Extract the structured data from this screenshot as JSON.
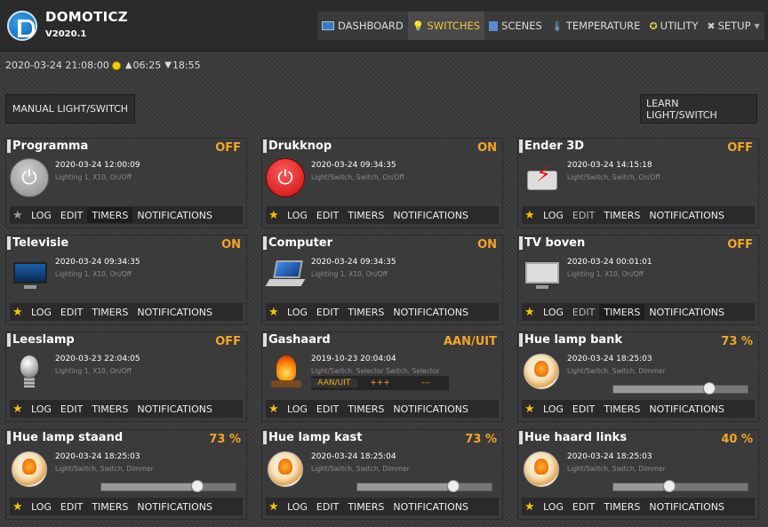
{
  "app": {
    "title": "DOMOTICZ",
    "version": "V2020.1"
  },
  "nav": [
    {
      "label": "DASHBOARD",
      "icon": "dashboard-icon"
    },
    {
      "label": "SWITCHES",
      "icon": "lightbulb-icon",
      "active": true
    },
    {
      "label": "SCENES",
      "icon": "scenes-icon"
    },
    {
      "label": "TEMPERATURE",
      "icon": "thermometer-icon"
    },
    {
      "label": "UTILITY",
      "icon": "utility-icon"
    },
    {
      "label": "SETUP",
      "icon": "tools-icon"
    }
  ],
  "datebar": {
    "datetime": "2020-03-24 21:08:00",
    "sunrise": "06:25",
    "sunset": "18:55"
  },
  "buttons": {
    "manual": "MANUAL LIGHT/SWITCH",
    "learn": "LEARN LIGHT/SWITCH"
  },
  "bar_labels": {
    "log": "LOG",
    "edit": "EDIT",
    "timers": "TIMERS",
    "notifications": "NOTIFICATIONS"
  },
  "colors": {
    "accent": "#f6c343",
    "status": "#f5a623"
  },
  "devices": [
    {
      "name": "Programma",
      "status": "OFF",
      "date": "2020-03-24 12:00:09",
      "type": "Lighting 1, X10, On/Off",
      "icon": "power-button-icon",
      "favorite": false
    },
    {
      "name": "Drukknop",
      "status": "ON",
      "date": "2020-03-24 09:34:35",
      "type": "Light/Switch, Switch, On/Off",
      "icon": "power-button-red-icon",
      "favorite": true
    },
    {
      "name": "Ender 3D",
      "status": "OFF",
      "date": "2020-03-24 14:15:18",
      "type": "Light/Switch, Switch, On/Off",
      "icon": "printer-icon",
      "favorite": true
    },
    {
      "name": "Televisie",
      "status": "ON",
      "date": "2020-03-24 09:34:35",
      "type": "Lighting 1, X10, On/Off",
      "icon": "tv-on-icon",
      "favorite": true
    },
    {
      "name": "Computer",
      "status": "ON",
      "date": "2020-03-24 09:34:35",
      "type": "Lighting 1, X10, On/Off",
      "icon": "laptop-icon",
      "favorite": true
    },
    {
      "name": "TV boven",
      "status": "OFF",
      "date": "2020-03-24 00:01:01",
      "type": "Lighting 1, X10, On/Off",
      "icon": "tv-off-icon",
      "favorite": true
    },
    {
      "name": "Leeslamp",
      "status": "OFF",
      "date": "2020-03-23 22:04:05",
      "type": "Lighting 1, X10, On/Off",
      "icon": "bulb-icon",
      "favorite": true
    },
    {
      "name": "Gashaard",
      "status": "AAN/UIT",
      "date": "2019-10-23 20:04:04",
      "type": "Light/Switch, Selector Switch, Selector",
      "icon": "fireplace-icon",
      "favorite": true,
      "selector": [
        "AAN/UIT",
        "+++",
        "---"
      ]
    },
    {
      "name": "Hue lamp bank",
      "status": "73 %",
      "date": "2020-03-24 18:25:03",
      "type": "Light/Switch, Switch, Dimmer",
      "icon": "hue-lamp-icon",
      "favorite": true,
      "level": 0.73
    },
    {
      "name": "Hue lamp staand",
      "status": "73 %",
      "date": "2020-03-24 18:25:03",
      "type": "Light/Switch, Switch, Dimmer",
      "icon": "hue-lamp-icon",
      "favorite": true,
      "level": 0.73
    },
    {
      "name": "Hue lamp kast",
      "status": "73 %",
      "date": "2020-03-24 18:25:04",
      "type": "Light/Switch, Switch, Dimmer",
      "icon": "hue-lamp-icon",
      "favorite": true,
      "level": 0.73
    },
    {
      "name": "Hue haard links",
      "status": "40 %",
      "date": "2020-03-24 18:25:03",
      "type": "Light/Switch, Switch, Dimmer",
      "icon": "hue-lamp-icon",
      "favorite": true,
      "level": 0.4
    }
  ]
}
